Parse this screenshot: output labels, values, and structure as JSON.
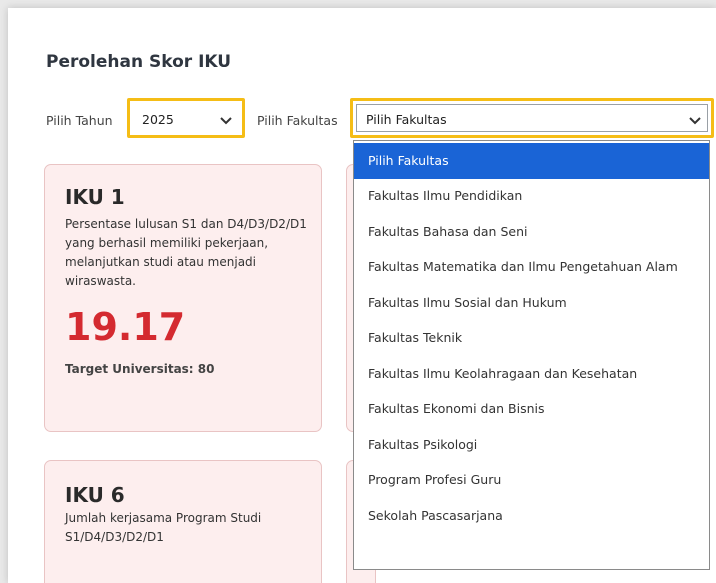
{
  "page": {
    "title": "Perolehan Skor IKU"
  },
  "filters": {
    "year_label": "Pilih Tahun",
    "year_value": "2025",
    "faculty_label": "Pilih Fakultas",
    "faculty_value": "Pilih Fakultas"
  },
  "dropdown": {
    "options": [
      "Pilih Fakultas",
      "Fakultas Ilmu Pendidikan",
      "Fakultas Bahasa dan Seni",
      "Fakultas Matematika dan Ilmu Pengetahuan Alam",
      "Fakultas Ilmu Sosial dan Hukum",
      "Fakultas Teknik",
      "Fakultas Ilmu Keolahragaan dan Kesehatan",
      "Fakultas Ekonomi dan Bisnis",
      "Fakultas Psikologi",
      "Program Profesi Guru",
      "Sekolah Pascasarjana"
    ],
    "selected_index": 0
  },
  "cards": [
    {
      "title": "IKU 1",
      "description": "Persentase lulusan S1 dan D4/D3/D2/D1 yang berhasil memiliki pekerjaan, melanjutkan studi atau menjadi wiraswasta.",
      "score": "19.17",
      "target": "Target Universitas: 80"
    },
    {
      "title": "IKU 6",
      "description": "Jumlah kerjasama Program Studi S1/D4/D3/D2/D1"
    }
  ],
  "colors": {
    "highlight": "#f5bd16",
    "score": "#d42a30",
    "selected_option": "#1a64d6",
    "card_bg": "#fdeeee"
  },
  "icons": {
    "select_chevron": "chevron-down-icon"
  }
}
